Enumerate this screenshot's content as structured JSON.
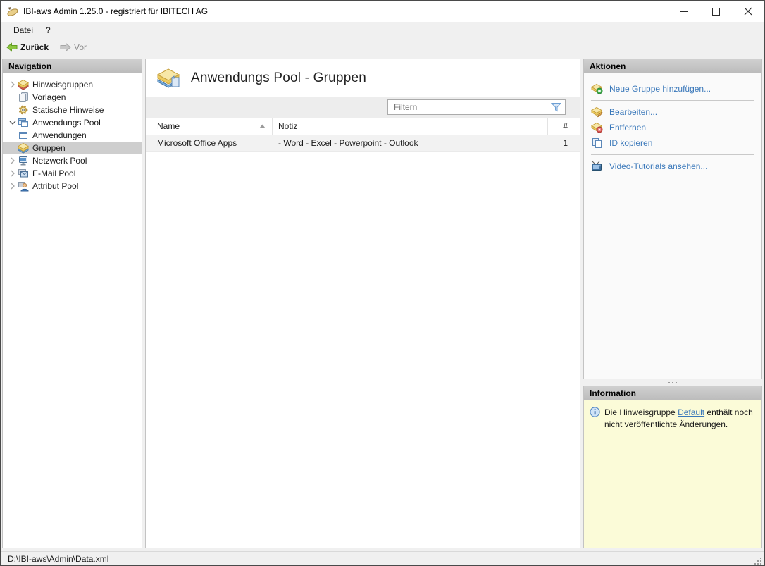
{
  "window": {
    "title": "IBI-aws Admin 1.25.0 - registriert für IBITECH AG"
  },
  "menubar": {
    "items": [
      {
        "label": "Datei"
      },
      {
        "label": "?"
      }
    ]
  },
  "toolbar": {
    "back_label": "Zurück",
    "forward_label": "Vor"
  },
  "navigation": {
    "header": "Navigation",
    "items": [
      {
        "label": "Hinweisgruppen"
      },
      {
        "label": "Vorlagen"
      },
      {
        "label": "Statische Hinweise"
      },
      {
        "label": "Anwendungs Pool"
      },
      {
        "label": "Anwendungen"
      },
      {
        "label": "Gruppen"
      },
      {
        "label": "Netzwerk Pool"
      },
      {
        "label": "E-Mail Pool"
      },
      {
        "label": "Attribut Pool"
      }
    ]
  },
  "main": {
    "title": "Anwendungs Pool - Gruppen",
    "filter_placeholder": "Filtern",
    "table": {
      "columns": {
        "name": "Name",
        "notiz": "Notiz",
        "count": "#"
      },
      "sort_column": "Name",
      "sort_direction": "asc",
      "rows": [
        {
          "name": "Microsoft Office Apps",
          "notiz": "- Word - Excel - Powerpoint - Outlook",
          "count": "1"
        }
      ]
    }
  },
  "actions": {
    "header": "Aktionen",
    "items": [
      {
        "label": "Neue Gruppe hinzufügen..."
      },
      {
        "label": "Bearbeiten..."
      },
      {
        "label": "Entfernen"
      },
      {
        "label": "ID kopieren"
      },
      {
        "label": "Video-Tutorials ansehen..."
      }
    ]
  },
  "information": {
    "header": "Information",
    "text_before": "Die Hinweisgruppe ",
    "link_label": "Default",
    "text_after": " enthält noch nicht veröffentlichte Änderungen."
  },
  "statusbar": {
    "path": "D:\\IBI-aws\\Admin\\Data.xml"
  },
  "colors": {
    "link_blue": "#3a78ba",
    "info_background": "#fbfbd8",
    "panel_header_gray": "#c6c6c6",
    "selected_row_gray": "#cecece",
    "back_arrow_green": "#8cc63f",
    "forward_arrow_gray": "#c0c0c0"
  }
}
